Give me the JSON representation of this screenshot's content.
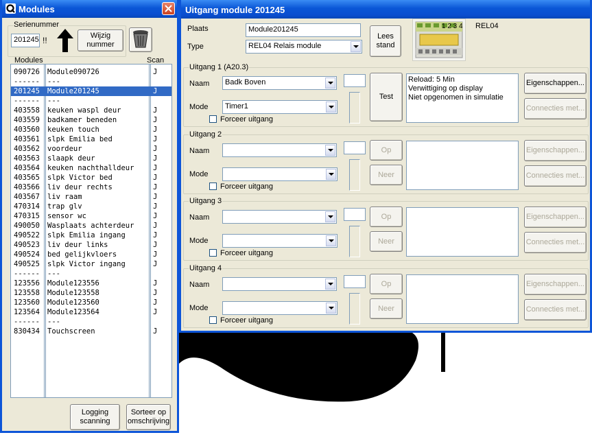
{
  "modules_window": {
    "title": "Modules",
    "serial_group_label": "Serienummer",
    "serial_value": "201245",
    "serial_marks": "!!",
    "change_button": "Wijzig nummer",
    "list_header_modules": "Modules",
    "list_header_scan": "Scan",
    "rows": [
      {
        "id": "090726",
        "name": "Module090726",
        "scan": "J"
      },
      {
        "id": "------",
        "name": "---",
        "scan": ""
      },
      {
        "id": "201245",
        "name": "Module201245",
        "scan": "J",
        "selected": true
      },
      {
        "id": "------",
        "name": "---",
        "scan": ""
      },
      {
        "id": "403558",
        "name": "keuken waspl deur",
        "scan": "J"
      },
      {
        "id": "403559",
        "name": "badkamer beneden",
        "scan": "J"
      },
      {
        "id": "403560",
        "name": "keuken touch",
        "scan": "J"
      },
      {
        "id": "403561",
        "name": "slpk Emilia bed",
        "scan": "J"
      },
      {
        "id": "403562",
        "name": "voordeur",
        "scan": "J"
      },
      {
        "id": "403563",
        "name": "slaapk deur",
        "scan": "J"
      },
      {
        "id": "403564",
        "name": "keuken nachthalldeur",
        "scan": "J"
      },
      {
        "id": "403565",
        "name": "slpk Victor bed",
        "scan": "J"
      },
      {
        "id": "403566",
        "name": "liv deur rechts",
        "scan": "J"
      },
      {
        "id": "403567",
        "name": "liv raam",
        "scan": "J"
      },
      {
        "id": "470314",
        "name": "trap glv",
        "scan": "J"
      },
      {
        "id": "470315",
        "name": "sensor wc",
        "scan": "J"
      },
      {
        "id": "490050",
        "name": "Wasplaats achterdeur",
        "scan": "J"
      },
      {
        "id": "490522",
        "name": "slpk Emilia ingang",
        "scan": "J"
      },
      {
        "id": "490523",
        "name": "liv deur links",
        "scan": "J"
      },
      {
        "id": "490524",
        "name": "bed gelijkvloers",
        "scan": "J"
      },
      {
        "id": "490525",
        "name": "slpk Victor ingang",
        "scan": "J"
      },
      {
        "id": "------",
        "name": "---",
        "scan": ""
      },
      {
        "id": "123556",
        "name": "Module123556",
        "scan": "J"
      },
      {
        "id": "123558",
        "name": "Module123558",
        "scan": "J"
      },
      {
        "id": "123560",
        "name": "Module123560",
        "scan": "J"
      },
      {
        "id": "123564",
        "name": "Module123564",
        "scan": "J"
      },
      {
        "id": "------",
        "name": "---",
        "scan": ""
      },
      {
        "id": "830434",
        "name": "Touchscreen",
        "scan": "J"
      }
    ],
    "logging_button": "Logging scanning",
    "sort_button": "Sorteer op omschrijving"
  },
  "detail_window": {
    "title": "Uitgang module 201245",
    "plaats_label": "Plaats",
    "plaats_value": "Module201245",
    "type_label": "Type",
    "type_value": "REL04 Relais module",
    "lees_button": "Lees stand",
    "device_name": "REL04",
    "device_numbers": "1 2 3 4",
    "outputs": [
      {
        "title": "Uitgang 1 (A20.3)",
        "naam": "Badk Boven",
        "mode": "Timer1",
        "force_label": "Forceer uitgang",
        "buttons": [
          "Test"
        ],
        "info": [
          "Reload: 5 Min",
          "Verwittiging op display",
          "Niet opgenomen in simulatie"
        ],
        "props": "Eigenschappen...",
        "conn": "Connecties met..."
      },
      {
        "title": "Uitgang 2",
        "naam": "",
        "mode": "",
        "force_label": "Forceer uitgang",
        "buttons": [
          "Op",
          "Neer"
        ],
        "info": [],
        "props": "Eigenschappen...",
        "conn": "Connecties met..."
      },
      {
        "title": "Uitgang 3",
        "naam": "",
        "mode": "",
        "force_label": "Forceer uitgang",
        "buttons": [
          "Op",
          "Neer"
        ],
        "info": [],
        "props": "Eigenschappen...",
        "conn": "Connecties met..."
      },
      {
        "title": "Uitgang 4",
        "naam": "",
        "mode": "",
        "force_label": "Forceer uitgang",
        "buttons": [
          "Op",
          "Neer"
        ],
        "info": [],
        "props": "Eigenschappen...",
        "conn": "Connecties met..."
      }
    ],
    "naam_label": "Naam",
    "mode_label": "Mode"
  },
  "colors": {
    "titlebar": "#0a56d6",
    "selection": "#316ac5",
    "window": "#ece9d8",
    "close": "#e0542b"
  }
}
